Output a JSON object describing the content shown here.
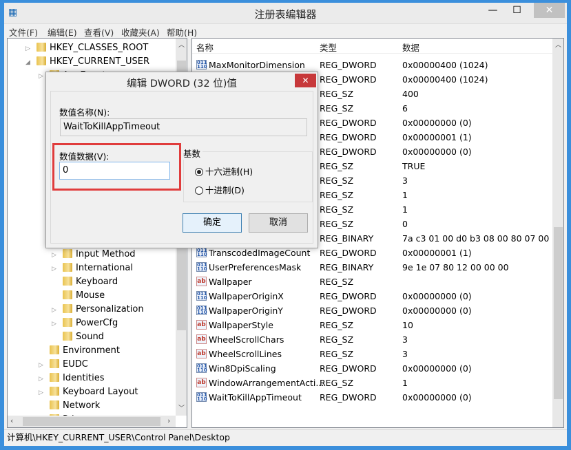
{
  "window": {
    "title": "注册表编辑器",
    "minimize": "—",
    "maximize": "☐",
    "close": "✕"
  },
  "menu": [
    "文件(F)",
    "编辑(E)",
    "查看(V)",
    "收藏夹(A)",
    "帮助(H)"
  ],
  "tree": [
    {
      "label": "HKEY_CLASSES_ROOT",
      "level": 0,
      "expander": "collapsed"
    },
    {
      "label": "HKEY_CURRENT_USER",
      "level": 0,
      "expander": "expanded"
    },
    {
      "label": "AppEvents",
      "level": 1,
      "expander": "collapsed"
    },
    {
      "label": "",
      "level": 1
    },
    {
      "label": "",
      "level": 1
    },
    {
      "label": "",
      "level": 1
    },
    {
      "label": "",
      "level": 1
    },
    {
      "label": "",
      "level": 1
    },
    {
      "label": "",
      "level": 1
    },
    {
      "label": "",
      "level": 1
    },
    {
      "label": "",
      "level": 1
    },
    {
      "label": "",
      "level": 1
    },
    {
      "label": "",
      "level": 1
    },
    {
      "label": "",
      "level": 1
    },
    {
      "label": "",
      "level": 1
    },
    {
      "label": "Input Method",
      "level": 2,
      "expander": "collapsed"
    },
    {
      "label": "International",
      "level": 2,
      "expander": "collapsed"
    },
    {
      "label": "Keyboard",
      "level": 2,
      "expander": "none"
    },
    {
      "label": "Mouse",
      "level": 2,
      "expander": "none"
    },
    {
      "label": "Personalization",
      "level": 2,
      "expander": "collapsed"
    },
    {
      "label": "PowerCfg",
      "level": 2,
      "expander": "collapsed"
    },
    {
      "label": "Sound",
      "level": 2,
      "expander": "none"
    },
    {
      "label": "Environment",
      "level": 1,
      "expander": "none"
    },
    {
      "label": "EUDC",
      "level": 1,
      "expander": "collapsed"
    },
    {
      "label": "Identities",
      "level": 1,
      "expander": "collapsed"
    },
    {
      "label": "Keyboard Layout",
      "level": 1,
      "expander": "collapsed"
    },
    {
      "label": "Network",
      "level": 1,
      "expander": "none"
    },
    {
      "label": "Pri",
      "level": 1,
      "expander": "collapsed"
    }
  ],
  "list": {
    "headers": {
      "name": "名称",
      "type": "类型",
      "data": "数据"
    },
    "rows": [
      {
        "name": "MaxMonitorDimension",
        "type": "REG_DWORD",
        "data": "0x00000400 (1024)"
      },
      {
        "name": "",
        "type": "REG_DWORD",
        "data": "0x00000400 (1024)"
      },
      {
        "name": "",
        "type": "REG_SZ",
        "data": "400"
      },
      {
        "name": "",
        "type": "REG_SZ",
        "data": "6"
      },
      {
        "name": "",
        "type": "REG_DWORD",
        "data": "0x00000000 (0)"
      },
      {
        "name": "",
        "type": "REG_DWORD",
        "data": "0x00000001 (1)"
      },
      {
        "name": "",
        "type": "REG_DWORD",
        "data": "0x00000000 (0)"
      },
      {
        "name": "",
        "type": "REG_SZ",
        "data": "TRUE"
      },
      {
        "name": "",
        "type": "REG_SZ",
        "data": "3"
      },
      {
        "name": "",
        "type": "REG_SZ",
        "data": "1"
      },
      {
        "name": "",
        "type": "REG_SZ",
        "data": "1"
      },
      {
        "name": "",
        "type": "REG_SZ",
        "data": "0"
      },
      {
        "name": "",
        "type": "REG_BINARY",
        "data": "7a c3 01 00 d0 b3 08 00 80 07 00 00"
      },
      {
        "name": "TranscodedImageCount",
        "type": "REG_DWORD",
        "data": "0x00000001 (1)"
      },
      {
        "name": "UserPreferencesMask",
        "type": "REG_BINARY",
        "data": "9e 1e 07 80 12 00 00 00"
      },
      {
        "name": "Wallpaper",
        "type": "REG_SZ",
        "data": ""
      },
      {
        "name": "WallpaperOriginX",
        "type": "REG_DWORD",
        "data": "0x00000000 (0)"
      },
      {
        "name": "WallpaperOriginY",
        "type": "REG_DWORD",
        "data": "0x00000000 (0)"
      },
      {
        "name": "WallpaperStyle",
        "type": "REG_SZ",
        "data": "10"
      },
      {
        "name": "WheelScrollChars",
        "type": "REG_SZ",
        "data": "3"
      },
      {
        "name": "WheelScrollLines",
        "type": "REG_SZ",
        "data": "3"
      },
      {
        "name": "Win8DpiScaling",
        "type": "REG_DWORD",
        "data": "0x00000000 (0)"
      },
      {
        "name": "WindowArrangementActi...",
        "type": "REG_SZ",
        "data": "1"
      },
      {
        "name": "WaitToKillAppTimeout",
        "type": "REG_DWORD",
        "data": "0x00000000 (0)"
      }
    ]
  },
  "status": "计算机\\HKEY_CURRENT_USER\\Control Panel\\Desktop",
  "dialog": {
    "title": "编辑 DWORD (32 位)值",
    "close": "✕",
    "name_label": "数值名称(N):",
    "name_value": "WaitToKillAppTimeout",
    "data_label": "数值数据(V):",
    "data_value": "0",
    "base_label": "基数",
    "hex_label": "十六进制(H)",
    "dec_label": "十进制(D)",
    "selected_base": "hex",
    "ok": "确定",
    "cancel": "取消",
    "highlight_color": "#e03c3c",
    "close_color": "#c7383a"
  },
  "watermark": "系统之家"
}
